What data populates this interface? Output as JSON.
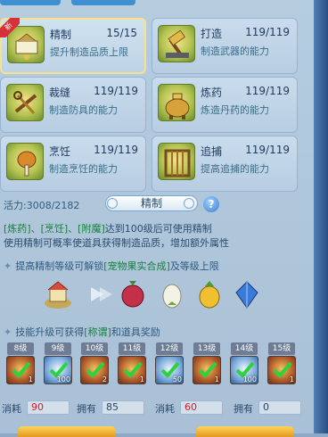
{
  "skills": [
    {
      "name": "精制",
      "value": "15/15",
      "desc": "提升制造品质上限",
      "icon": "refine-icon",
      "badge": "新",
      "selected": true
    },
    {
      "name": "打造",
      "value": "119/119",
      "desc": "制造武器的能力",
      "icon": "hammer-icon",
      "selected": false
    },
    {
      "name": "裁缝",
      "value": "119/119",
      "desc": "制造防具的能力",
      "icon": "scissors-icon",
      "selected": false
    },
    {
      "name": "炼药",
      "value": "119/119",
      "desc": "炼造丹药的能力",
      "icon": "cauldron-icon",
      "selected": false
    },
    {
      "name": "烹饪",
      "value": "119/119",
      "desc": "制造烹饪的能力",
      "icon": "drumstick-icon",
      "selected": false
    },
    {
      "name": "追捕",
      "value": "119/119",
      "desc": "提高追捕的能力",
      "icon": "cage-icon",
      "selected": false
    }
  ],
  "vitality": {
    "label": "活力:",
    "value": "3008/2182"
  },
  "mode": {
    "label": "精制"
  },
  "help_icon": "?",
  "info": {
    "line1_green": "[炼药]、[烹饪]、[附魔]",
    "line1_rest": "达到100级后可使用精制",
    "line2": "使用精制可概率使道具获得制造品质，增加额外属性"
  },
  "unlock": {
    "prefix": "提高精制等级可解锁",
    "highlight": "[宠物果实合成]",
    "suffix": "及等级上限"
  },
  "unlock_items": [
    "pet-house-icon",
    "arrow-icon",
    "red-fruit-icon",
    "egg-icon",
    "golden-pineapple-icon",
    "blue-gem-icon"
  ],
  "reward": {
    "prefix": "技能升级可获得",
    "highlight": "[称谓]",
    "suffix": "和道具奖励"
  },
  "levels": [
    "8级",
    "9级",
    "10级",
    "11级",
    "12级",
    "13级",
    "14级",
    "15级"
  ],
  "reward_slots": [
    {
      "type": "scroll",
      "count": "1"
    },
    {
      "type": "orb",
      "count": "100"
    },
    {
      "type": "scroll",
      "count": "2"
    },
    {
      "type": "scroll",
      "count": "1"
    },
    {
      "type": "orb",
      "count": "50"
    },
    {
      "type": "gift",
      "count": "1"
    },
    {
      "type": "orb",
      "count": "100"
    },
    {
      "type": "chest",
      "count": "1"
    }
  ],
  "cost_row": {
    "consume_label": "消耗",
    "consume_value": "90",
    "own_label": "拥有",
    "own_value": "85",
    "consume2_label": "消耗",
    "consume2_value": "60",
    "own2_label": "拥有",
    "own2_value": "0"
  }
}
